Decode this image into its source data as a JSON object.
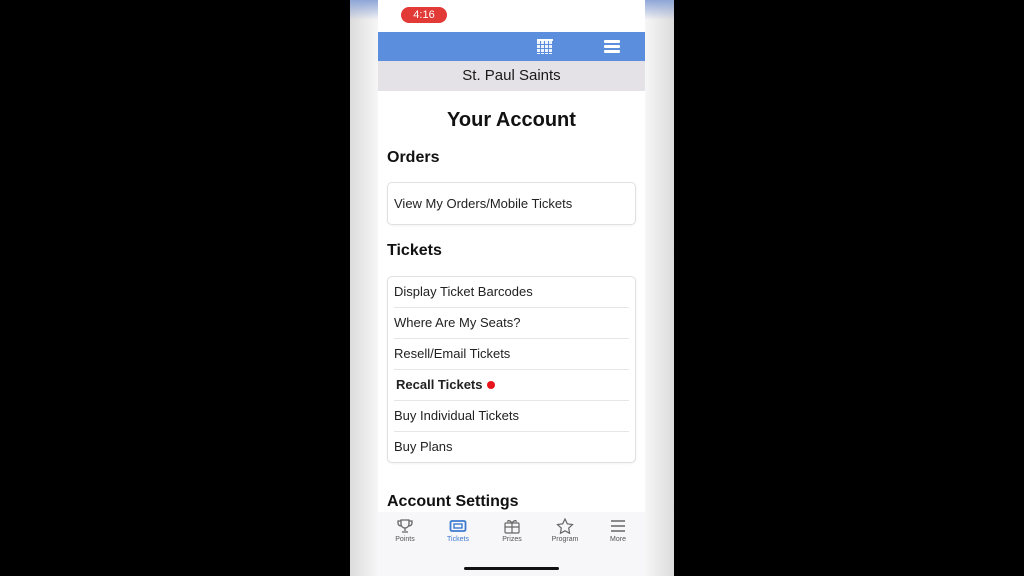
{
  "status_bar": {
    "time": "4:16"
  },
  "header": {
    "team_name": "St. Paul Saints"
  },
  "page": {
    "title": "Your Account",
    "sections": {
      "orders": {
        "title": "Orders",
        "items": [
          "View My Orders/Mobile Tickets"
        ]
      },
      "tickets": {
        "title": "Tickets",
        "items": [
          {
            "label": "Display Ticket Barcodes"
          },
          {
            "label": "Where Are My Seats?"
          },
          {
            "label": "Resell/Email Tickets"
          },
          {
            "label": "Recall Tickets",
            "highlight": true
          },
          {
            "label": "Buy Individual Tickets"
          },
          {
            "label": "Buy Plans"
          }
        ]
      },
      "account_settings": {
        "title": "Account Settings"
      }
    }
  },
  "tab_bar": {
    "active": "Tickets",
    "tabs": [
      {
        "label": "Points",
        "icon": "trophy-icon"
      },
      {
        "label": "Tickets",
        "icon": "ticket-icon"
      },
      {
        "label": "Prizes",
        "icon": "gift-icon"
      },
      {
        "label": "Program",
        "icon": "star-icon"
      },
      {
        "label": "More",
        "icon": "menu-icon"
      }
    ]
  },
  "colors": {
    "header_blue": "#5b8edc",
    "time_pill": "#e23a36",
    "active_tab": "#3d7ad1",
    "indicator_dot": "#e8141c"
  }
}
